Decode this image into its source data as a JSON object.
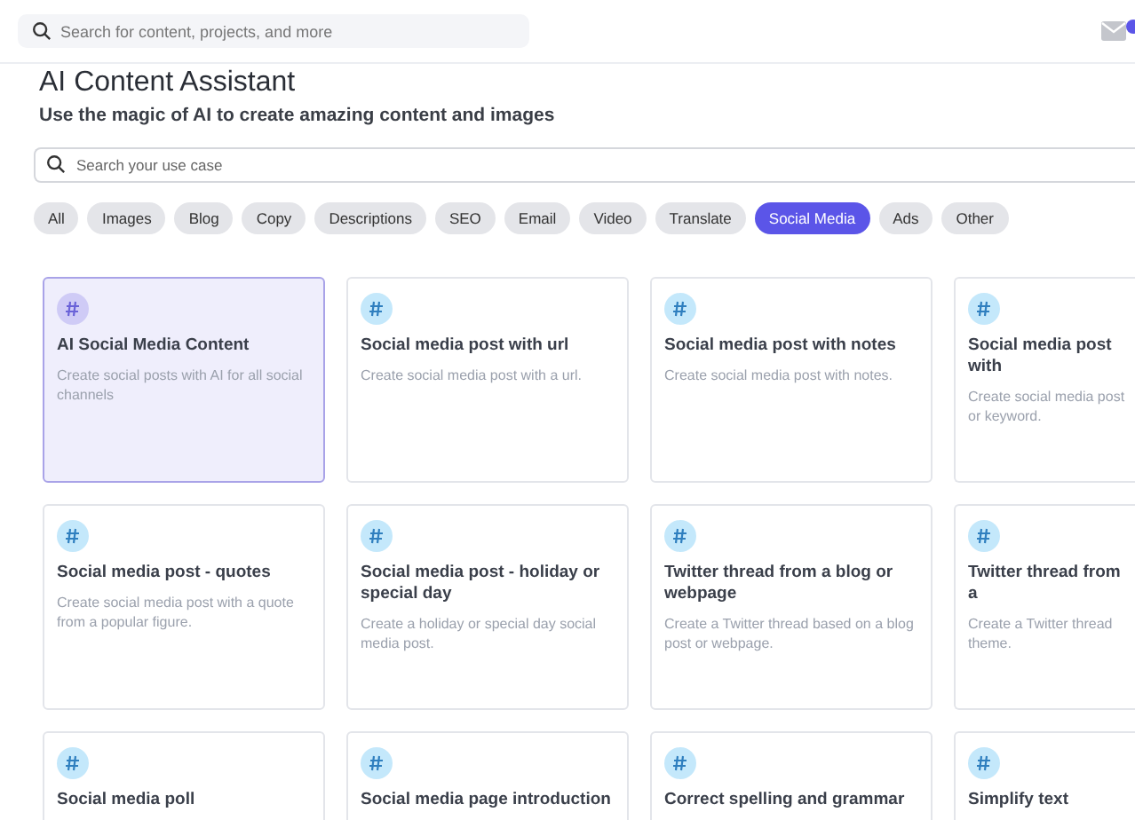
{
  "top_bar": {
    "search": {
      "placeholder": "Search for content, projects, and more"
    }
  },
  "header": {
    "title": "AI Content Assistant",
    "subtitle": "Use the magic of AI to create amazing content and images"
  },
  "use_case_search": {
    "placeholder": "Search your use case"
  },
  "filters": [
    {
      "label": "All",
      "selected": false
    },
    {
      "label": "Images",
      "selected": false
    },
    {
      "label": "Blog",
      "selected": false
    },
    {
      "label": "Copy",
      "selected": false
    },
    {
      "label": "Descriptions",
      "selected": false
    },
    {
      "label": "SEO",
      "selected": false
    },
    {
      "label": "Email",
      "selected": false
    },
    {
      "label": "Video",
      "selected": false
    },
    {
      "label": "Translate",
      "selected": false
    },
    {
      "label": "Social Media",
      "selected": true
    },
    {
      "label": "Ads",
      "selected": false
    },
    {
      "label": "Other",
      "selected": false
    }
  ],
  "cards": [
    {
      "title": "AI Social Media Content",
      "description": "Create social posts with AI for all social channels",
      "selected": true
    },
    {
      "title": "Social media post with url",
      "description": "Create social media post with a url.",
      "selected": false
    },
    {
      "title": "Social media post with notes",
      "description": "Create social media post with notes.",
      "selected": false
    },
    {
      "title": "Social media post with",
      "description": "Create social media post or keyword.",
      "selected": false
    },
    {
      "title": "Social media post - quotes",
      "description": "Create social media post with a quote from a popular figure.",
      "selected": false
    },
    {
      "title": "Social media post - holiday or special day",
      "description": "Create a holiday or special day social media post.",
      "selected": false
    },
    {
      "title": "Twitter thread from a blog or webpage",
      "description": "Create a Twitter thread based on a blog post or webpage.",
      "selected": false
    },
    {
      "title": "Twitter thread from a",
      "description": "Create a Twitter thread theme.",
      "selected": false
    },
    {
      "title": "Social media poll",
      "selected": false
    },
    {
      "title": "Social media page introduction",
      "selected": false
    },
    {
      "title": "Correct spelling and grammar",
      "selected": false
    },
    {
      "title": "Simplify text",
      "selected": false
    }
  ]
}
